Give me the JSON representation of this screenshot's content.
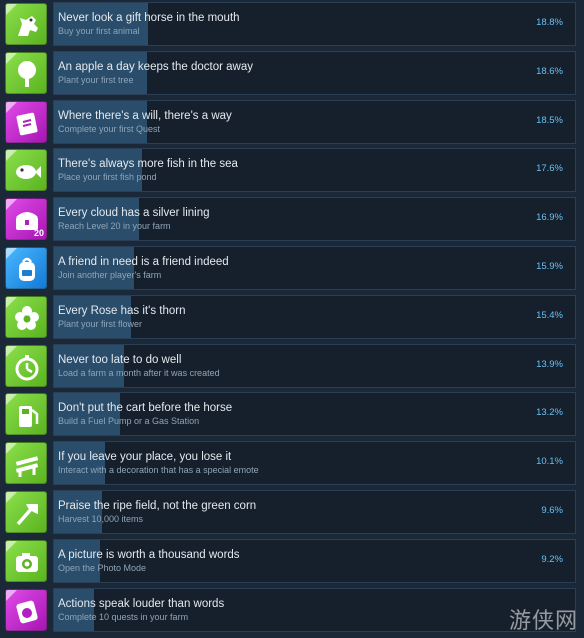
{
  "colors": {
    "background": "#1b2838",
    "panel": "#16202d",
    "progress_fill": "#2a4d6b",
    "percent_text": "#66c0f4",
    "icon_green": "#6fcb2f",
    "icon_purple": "#c62fd3",
    "icon_blue": "#2a95ee"
  },
  "achievements": [
    {
      "title": "Never look a gift horse in the mouth",
      "description": "Buy your first animal",
      "percent": "18.8%",
      "percent_value": 18.8,
      "icon": "horse-icon",
      "icon_color": "green",
      "badge": ""
    },
    {
      "title": "An apple a day keeps the doctor away",
      "description": "Plant your first tree",
      "percent": "18.6%",
      "percent_value": 18.6,
      "icon": "tree-icon",
      "icon_color": "green",
      "badge": ""
    },
    {
      "title": "Where there's a will, there's a way",
      "description": "Complete your first Quest",
      "percent": "18.5%",
      "percent_value": 18.5,
      "icon": "quest-scroll-icon",
      "icon_color": "purple",
      "badge": ""
    },
    {
      "title": "There's always more fish in the sea",
      "description": "Place your first fish pond",
      "percent": "17.6%",
      "percent_value": 17.6,
      "icon": "fish-icon",
      "icon_color": "green",
      "badge": ""
    },
    {
      "title": "Every cloud has a silver lining",
      "description": "Reach Level 20 in your farm",
      "percent": "16.9%",
      "percent_value": 16.9,
      "icon": "treasure-chest-icon",
      "icon_color": "purple",
      "badge": "20"
    },
    {
      "title": "A friend in need is a friend indeed",
      "description": "Join another player's farm",
      "percent": "15.9%",
      "percent_value": 15.9,
      "icon": "backpack-icon",
      "icon_color": "blue",
      "badge": ""
    },
    {
      "title": "Every Rose has it's thorn",
      "description": "Plant your first flower",
      "percent": "15.4%",
      "percent_value": 15.4,
      "icon": "flower-icon",
      "icon_color": "green",
      "badge": ""
    },
    {
      "title": "Never too late to do well",
      "description": "Load a farm a month after it was created",
      "percent": "13.9%",
      "percent_value": 13.9,
      "icon": "stopwatch-icon",
      "icon_color": "green",
      "badge": ""
    },
    {
      "title": "Don't put the cart before the horse",
      "description": "Build a Fuel Pump or a Gas Station",
      "percent": "13.2%",
      "percent_value": 13.2,
      "icon": "fuel-pump-icon",
      "icon_color": "green",
      "badge": ""
    },
    {
      "title": "If you leave your place, you lose it",
      "description": "Interact with a decoration that has a special emote",
      "percent": "10.1%",
      "percent_value": 10.1,
      "icon": "bench-icon",
      "icon_color": "green",
      "badge": ""
    },
    {
      "title": "Praise the ripe field, not the green corn",
      "description": "Harvest 10,000 items",
      "percent": "9.6%",
      "percent_value": 9.6,
      "icon": "axe-icon",
      "icon_color": "green",
      "badge": ""
    },
    {
      "title": "A picture is worth a thousand words",
      "description": "Open the Photo Mode",
      "percent": "9.2%",
      "percent_value": 9.2,
      "icon": "camera-icon",
      "icon_color": "green",
      "badge": ""
    },
    {
      "title": "Actions speak louder than words",
      "description": "Complete 10 quests in your farm",
      "percent": "",
      "percent_value": 8.0,
      "icon": "quest-stamp-icon",
      "icon_color": "purple",
      "badge": ""
    }
  ],
  "watermark": "游侠网"
}
